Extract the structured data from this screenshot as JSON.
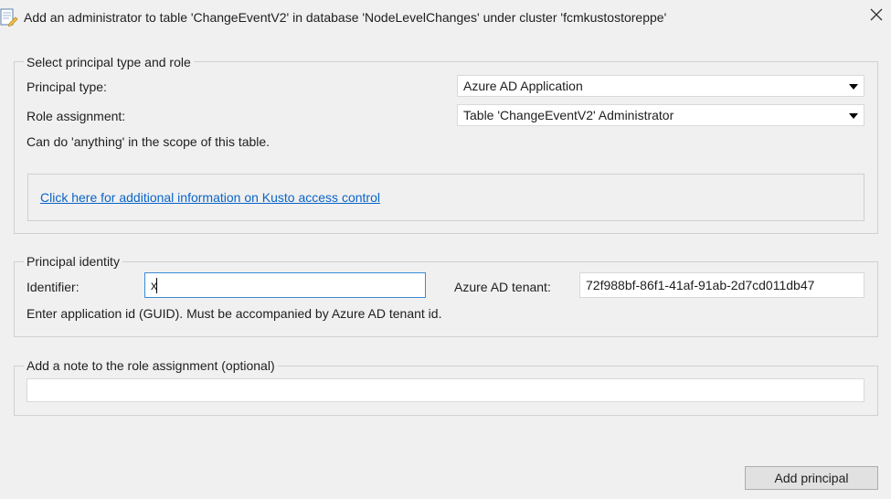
{
  "window": {
    "title": "Add an administrator to table 'ChangeEventV2' in database 'NodeLevelChanges' under cluster 'fcmkustostoreppe'",
    "icon": "dialog-edit-icon",
    "close_icon": "close-icon"
  },
  "principal_role": {
    "legend": "Select principal type and role",
    "principal_type_label": "Principal type:",
    "principal_type_value": "Azure AD Application",
    "role_assignment_label": "Role assignment:",
    "role_assignment_value": "Table 'ChangeEventV2' Administrator",
    "role_description": "Can do 'anything' in the scope of this table.",
    "info_link": "Click here for additional information on Kusto access control"
  },
  "principal_identity": {
    "legend": "Principal identity",
    "identifier_label": "Identifier:",
    "identifier_value": "x",
    "tenant_label": "Azure AD tenant:",
    "tenant_value": "72f988bf-86f1-41af-91ab-2d7cd011db47",
    "hint": "Enter application id (GUID). Must be accompanied by Azure AD tenant id."
  },
  "note": {
    "legend": "Add a note to the role assignment (optional)",
    "value": ""
  },
  "footer": {
    "add_principal_label": "Add principal"
  },
  "colors": {
    "link": "#0a64c8",
    "focus_border": "#3c8ad6",
    "background": "#f0f0f0"
  }
}
